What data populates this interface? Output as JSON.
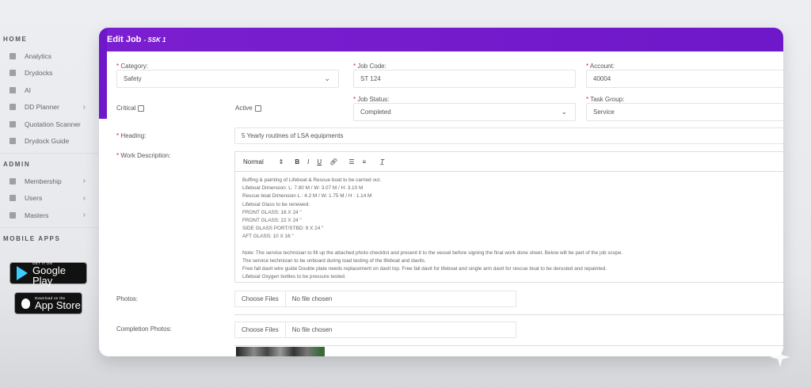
{
  "sidebar": {
    "home_label": "HOME",
    "home_items": [
      {
        "label": "Analytics",
        "icon": "chart-icon"
      },
      {
        "label": "Drydocks",
        "icon": "ship-icon"
      },
      {
        "label": "AI",
        "icon": "ai-icon"
      },
      {
        "label": "DD Planner",
        "icon": "planner-icon",
        "has_children": true
      },
      {
        "label": "Quotation Scanner",
        "icon": "scanner-icon"
      },
      {
        "label": "Drydock Guide",
        "icon": "guide-icon"
      }
    ],
    "admin_label": "ADMIN",
    "admin_items": [
      {
        "label": "Membership",
        "icon": "membership-icon",
        "has_children": true
      },
      {
        "label": "Users",
        "icon": "users-icon",
        "has_children": true
      },
      {
        "label": "Masters",
        "icon": "masters-icon",
        "has_children": true
      }
    ],
    "mobile_label": "MOBILE APPS",
    "google_play": {
      "small": "GET IT ON",
      "big": "Google Play"
    },
    "app_store": {
      "small": "Download on the",
      "big": "App Store"
    }
  },
  "form": {
    "title": "Edit Job",
    "subtitle": "- SSK 1",
    "category": {
      "label": "Category:",
      "value": "Safety"
    },
    "job_code": {
      "label": "Job Code:",
      "value": "ST 124"
    },
    "account": {
      "label": "Account:",
      "value": "40004"
    },
    "critical": {
      "label": "Critical",
      "checked": false
    },
    "active": {
      "label": "Active",
      "checked": false
    },
    "job_status": {
      "label": "Job Status:",
      "value": "Completed"
    },
    "task_group": {
      "label": "Task Group:",
      "value": "Service"
    },
    "heading": {
      "label": "Heading:",
      "value": "5 Yearly routines of LSA equipments"
    },
    "work_description": {
      "label": "Work Description:",
      "format": "Normal",
      "lines": [
        "Buffing & painting of Lifeboat & Rescue boat to be carried out.",
        "Lifeboat Dimension: L: 7.80 M / W: 3.07 M / H: 3.10 M",
        "Rescue boat Dimension L : 4.2 M / W: 1.75 M / H : 1.14 M",
        "Lifeboat Glass to be renewed:",
        "FRONT GLASS: 16 X 24 \"",
        "FRONT GLASS: 22 X 24 \"",
        "SIDE GLASS PORT/STBD: 9 X 24 \"",
        "AFT GLASS: 10 X 16 \"",
        "",
        "Note: The service technician to fill up the attached photo checklist and present it to the vessel before signing the final work done sheet. Below will be part of the job scope.",
        "The service technician to be onboard during load testing of the lifeboat and davits.",
        "Free fall davit wire guide Double plate needs replacement on davit top. Free fall davit for lifeboat and single arm davit for rescue boat to be derusted and repainted.",
        "Lifeboat Oxygen bottles to be pressure tested."
      ]
    },
    "photos": {
      "label": "Photos:",
      "button": "Choose Files",
      "status": "No file chosen"
    },
    "completion_photos": {
      "label": "Completion Photos:",
      "button": "Choose Files",
      "status": "No file chosen"
    }
  },
  "colors": {
    "accent": "#7b1fd0",
    "required": "#dd2222"
  }
}
